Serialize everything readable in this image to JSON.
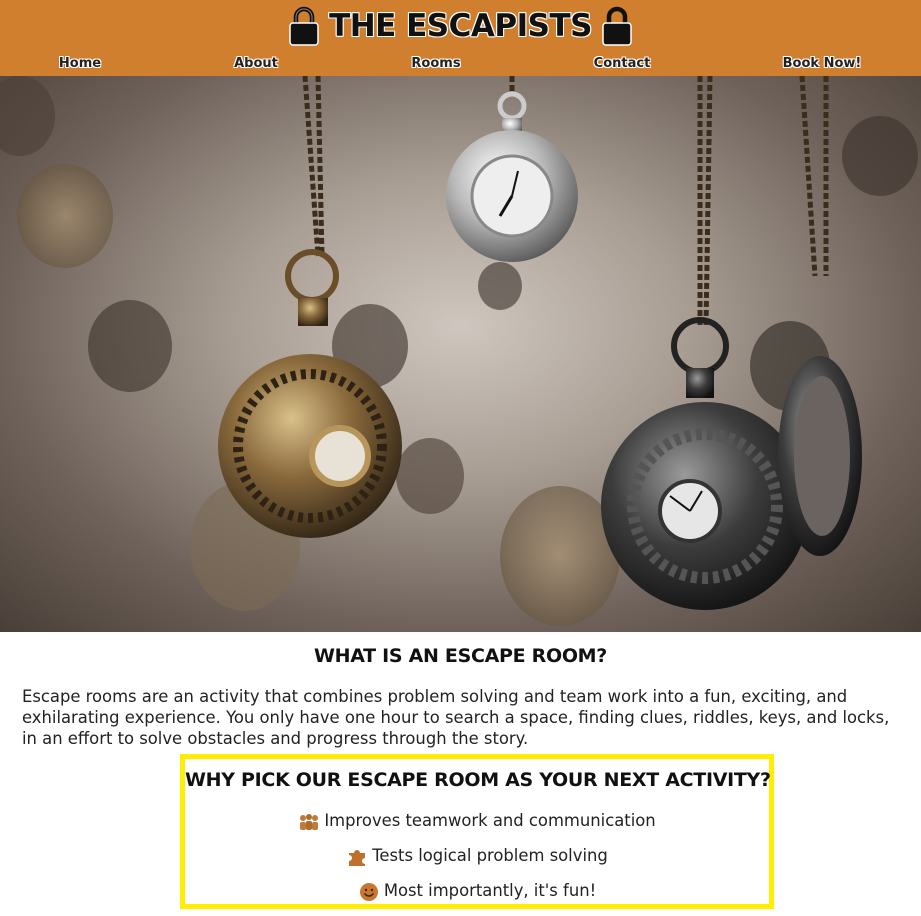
{
  "header": {
    "title": "THE ESCAPISTS",
    "logo_icon": "padlock-icon",
    "background_color": "#d07f2e"
  },
  "nav": {
    "items": [
      {
        "label": "Home"
      },
      {
        "label": "About"
      },
      {
        "label": "Rooms"
      },
      {
        "label": "Contact"
      },
      {
        "label": "Book Now!"
      }
    ]
  },
  "hero": {
    "image": "hanging pocket watches photo"
  },
  "intro": {
    "heading": "WHAT IS AN ESCAPE ROOM?",
    "paragraph": "Escape rooms are an activity that combines problem solving and team work into a fun, exciting, and exhilarating experience. You only have one hour to search a space, finding clues, riddles, keys, and locks, in an effort to solve obstacles and progress through the story."
  },
  "why": {
    "heading": "WHY PICK OUR ESCAPE ROOM AS YOUR NEXT ACTIVITY?",
    "border_color": "#ffee00",
    "items": [
      {
        "icon": "family-icon",
        "text": "Improves teamwork and communication"
      },
      {
        "icon": "puzzle-piece-icon",
        "text": "Tests logical problem solving"
      },
      {
        "icon": "smile-emoji-icon",
        "text": "Most importantly, it's fun!"
      }
    ]
  }
}
